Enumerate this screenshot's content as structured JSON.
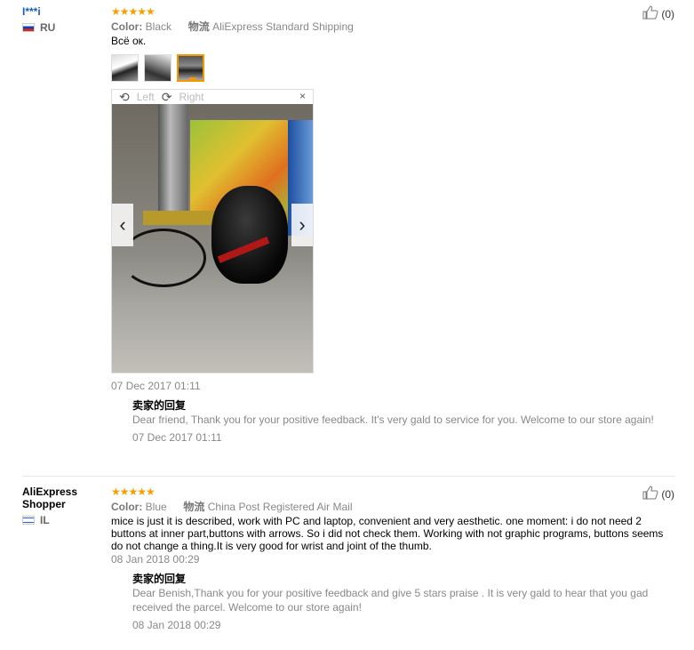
{
  "reviews": [
    {
      "user": "I***i",
      "country": "RU",
      "stars": "★★★★★",
      "color_label": "Color:",
      "color_value": "Black",
      "logistics_label": "物流",
      "logistics_value": "AliExpress Standard Shipping",
      "text": "Всё ок.",
      "viewer": {
        "left": "Left",
        "right": "Right",
        "close": "×"
      },
      "date": "07 Dec 2017 01:11",
      "helpful_count": "(0)",
      "reply": {
        "title": "卖家的回复",
        "text": "Dear friend, Thank you for your positive feedback. It's very gald to service for you. Welcome to our store again!",
        "date": "07 Dec 2017 01:11"
      }
    },
    {
      "user": "AliExpress Shopper",
      "country": "IL",
      "stars": "★★★★★",
      "color_label": "Color:",
      "color_value": "Blue",
      "logistics_label": "物流",
      "logistics_value": "China Post Registered Air Mail",
      "text": "mice is just it is described, work with PC and laptop, convenient and very aesthetic. one moment: i do not need 2 buttons at inner part,buttons with arrows. So i did not check them. Working with not graphic programs, buttons seems do not change a thing.It is very good for wrist and joint of the thumb.",
      "date": "08 Jan 2018 00:29",
      "helpful_count": "(0)",
      "reply": {
        "title": "卖家的回复",
        "text": "Dear Benish,Thank you for your positive feedback and give 5 stars praise . It is very gald to hear that you gad received the parcel. Welcome to our store again!",
        "date": "08 Jan 2018 00:29"
      }
    }
  ],
  "colors": {
    "star": "#f6a000",
    "link": "#1c5bb8",
    "active_thumb": "#f39800"
  }
}
